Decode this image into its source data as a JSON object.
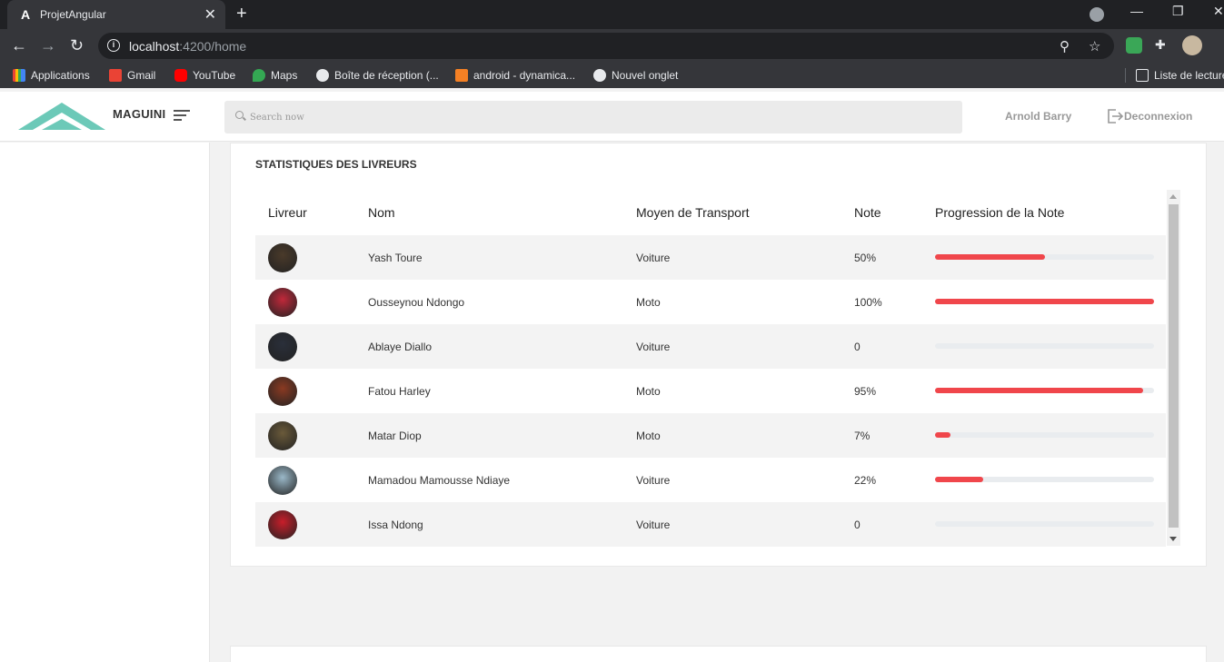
{
  "browser": {
    "tab_title": "ProjetAngular",
    "tab_close": "✕",
    "new_tab": "+",
    "url_host": "localhost",
    "url_path": ":4200/home",
    "bookmarks": [
      {
        "label": "Applications",
        "icon": "apps-grid-icon",
        "color": "#ea4335"
      },
      {
        "label": "Gmail",
        "icon": "gmail-icon",
        "color": "#ea4335"
      },
      {
        "label": "YouTube",
        "icon": "youtube-icon",
        "color": "#ff0000"
      },
      {
        "label": "Maps",
        "icon": "maps-pin-icon",
        "color": "#34a853"
      },
      {
        "label": "Boîte de réception (...",
        "icon": "globe-icon",
        "color": "#e8eaed"
      },
      {
        "label": "android - dynamica...",
        "icon": "stackoverflow-icon",
        "color": "#f48024"
      },
      {
        "label": "Nouvel onglet",
        "icon": "globe-icon",
        "color": "#e8eaed"
      }
    ],
    "reading_list": "Liste de lecture"
  },
  "header": {
    "brand": "MAGUINI",
    "search_placeholder": "Search now",
    "user_name": "Arnold Barry",
    "logout_label": "Deconnexion"
  },
  "card": {
    "title": "STATISTIQUES DES LIVREURS",
    "columns": [
      "Livreur",
      "Nom",
      "Moyen de Transport",
      "Note",
      "Progression de la Note"
    ],
    "rows": [
      {
        "name": "Yash Toure",
        "transport": "Voiture",
        "note": "50%",
        "progress": 0.5,
        "avatar_color": "#4a3a2a"
      },
      {
        "name": "Ousseynou Ndongo",
        "transport": "Moto",
        "note": "100%",
        "progress": 1.0,
        "avatar_color": "#c0283a"
      },
      {
        "name": "Ablaye Diallo",
        "transport": "Voiture",
        "note": "0",
        "progress": 0,
        "avatar_color": "#2a2f3a"
      },
      {
        "name": "Fatou Harley",
        "transport": "Moto",
        "note": "95%",
        "progress": 0.95,
        "avatar_color": "#8a3a22"
      },
      {
        "name": "Matar Diop",
        "transport": "Moto",
        "note": "7%",
        "progress": 0.07,
        "avatar_color": "#6a5a3a"
      },
      {
        "name": "Mamadou Mamousse Ndiaye",
        "transport": "Voiture",
        "note": "22%",
        "progress": 0.22,
        "avatar_color": "#9ab8c8"
      },
      {
        "name": "Issa Ndong",
        "transport": "Voiture",
        "note": "0",
        "progress": 0,
        "avatar_color": "#c81e2a"
      }
    ]
  },
  "colors": {
    "progress": "#f0464b",
    "logo": "#6cc9b8"
  }
}
